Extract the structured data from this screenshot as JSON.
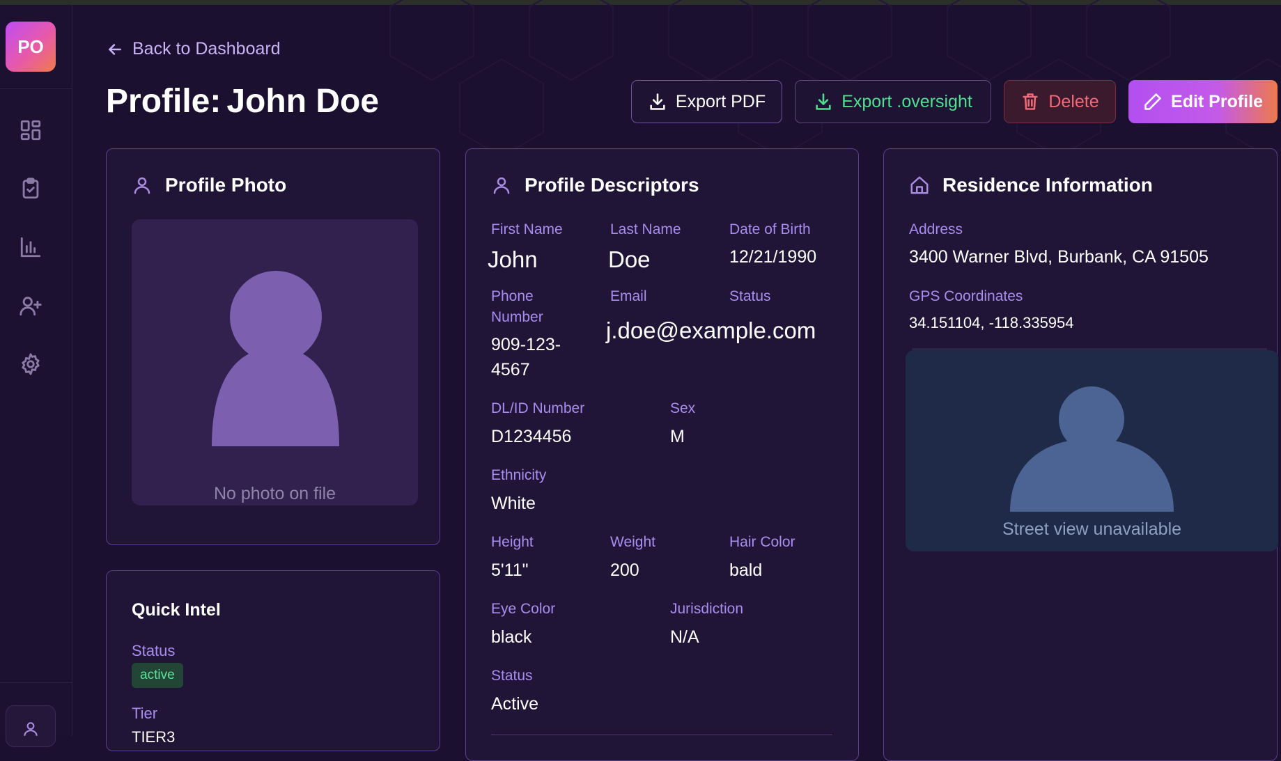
{
  "sidebar": {
    "logo": "PO",
    "nav_icons": [
      "dashboard-grid-icon",
      "clipboard-check-icon",
      "bar-chart-icon",
      "user-plus-icon",
      "gear-icon"
    ],
    "bottom_icon": "user-icon"
  },
  "header": {
    "back_label": "Back to Dashboard",
    "title_prefix": "Profile:",
    "title_name": "John Doe"
  },
  "actions": {
    "export_pdf": "Export PDF",
    "export_oversight": "Export .oversight",
    "delete": "Delete",
    "edit": "Edit Profile"
  },
  "photo_card": {
    "title": "Profile Photo",
    "placeholder": "No photo on file"
  },
  "quick_intel": {
    "title": "Quick Intel",
    "status_label": "Status",
    "status_value": "active",
    "tier_label": "Tier",
    "tier_value": "TIER3"
  },
  "descriptors": {
    "title": "Profile Descriptors",
    "first_name_label": "First Name",
    "first_name": "John",
    "last_name_label": "Last Name",
    "last_name": "Doe",
    "dob_label": "Date of Birth",
    "dob": "12/21/1990",
    "phone_label": "Phone Number",
    "phone": "909-123-4567",
    "email_label": "Email",
    "email": "j.doe@example.com",
    "status_label": "Status",
    "dl_label": "DL/ID Number",
    "dl": "D1234456",
    "sex_label": "Sex",
    "sex": "M",
    "ethnicity_label": "Ethnicity",
    "ethnicity": "White",
    "height_label": "Height",
    "height": "5'11\"",
    "weight_label": "Weight",
    "weight": "200",
    "hair_label": "Hair Color",
    "hair": "bald",
    "eye_label": "Eye Color",
    "eye": "black",
    "jurisdiction_label": "Jurisdiction",
    "jurisdiction": "N/A",
    "status2_label": "Status",
    "status2": "Active"
  },
  "residence": {
    "title": "Residence Information",
    "address_label": "Address",
    "address": "3400 Warner Blvd, Burbank, CA 91505",
    "gps_label": "GPS Coordinates",
    "gps": "34.151104, -118.335954",
    "street_view": "Street view unavailable"
  },
  "colors": {
    "background": "#1b1030",
    "card": "#211537",
    "accent": "#a98cf0",
    "success": "#4ee08f",
    "danger": "#f06a78"
  }
}
